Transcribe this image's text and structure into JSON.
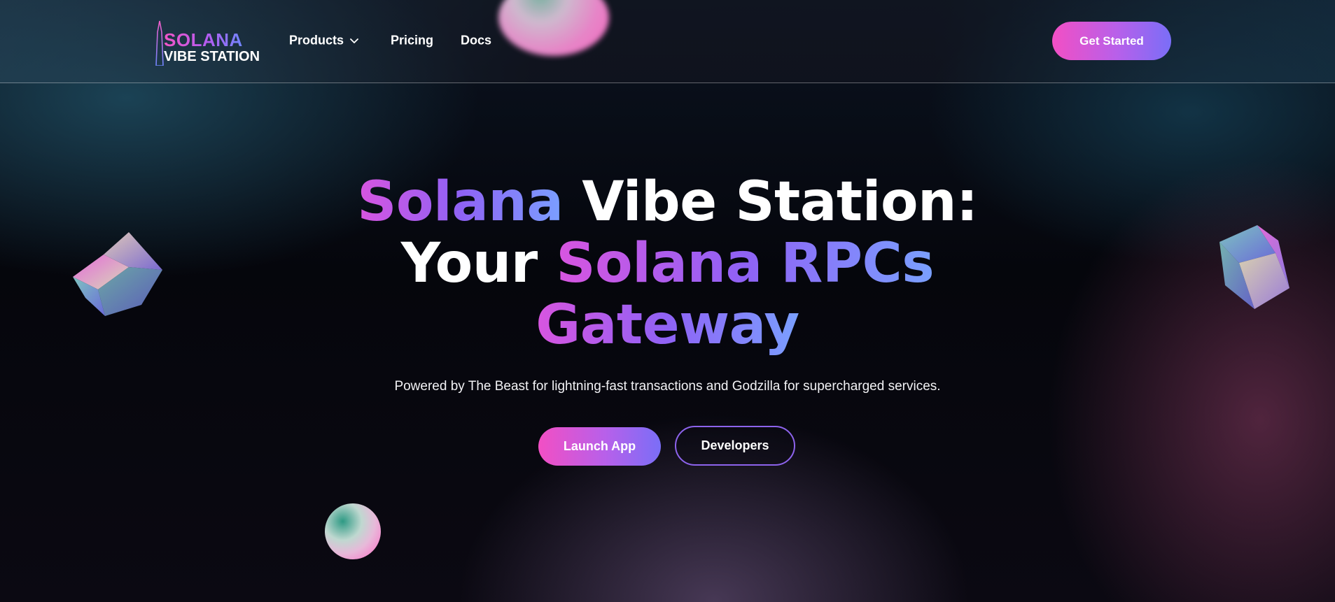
{
  "header": {
    "logo": {
      "line1": "SOLANA",
      "line2": "VIBE STATION"
    },
    "nav": {
      "products": "Products",
      "pricing": "Pricing",
      "docs": "Docs"
    },
    "cta": "Get Started"
  },
  "hero": {
    "title": {
      "line1_accent": "Solana",
      "line1_rest": " Vibe Station:",
      "line2_plain": "Your ",
      "line2_accent": "Solana RPCs",
      "line3_accent": "Gateway"
    },
    "subtitle": "Powered by The Beast for lightning-fast transactions and Godzilla for supercharged services.",
    "buttons": {
      "launch": "Launch App",
      "developers": "Developers"
    }
  },
  "colors": {
    "accent_pink": "#f24fc4",
    "accent_purple": "#8f62f5",
    "accent_blue": "#7aa0ff",
    "background": "#05060c"
  },
  "icons": [
    "tower-icon",
    "chevron-down-icon",
    "cube-icon",
    "orb-icon"
  ]
}
